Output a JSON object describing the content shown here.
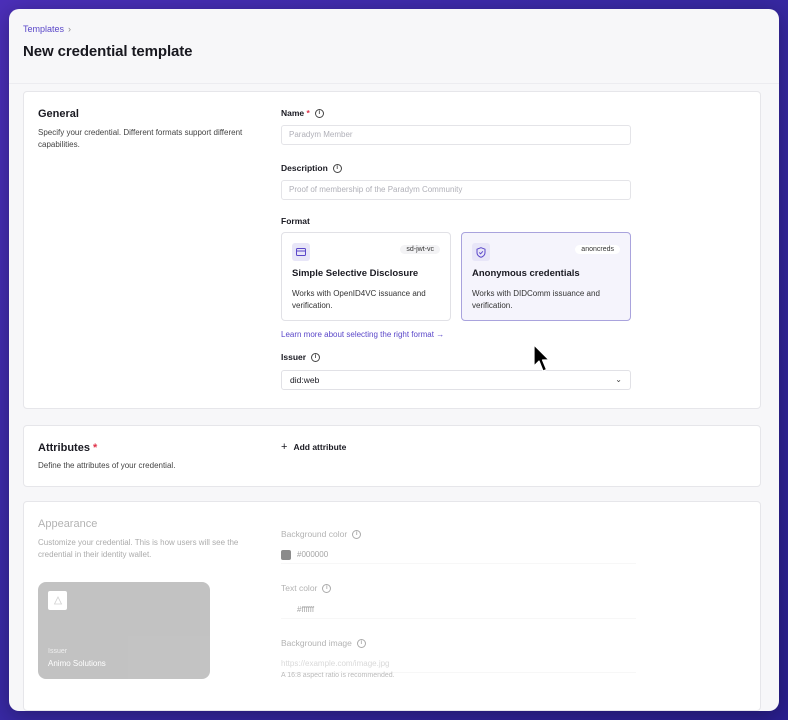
{
  "breadcrumb": {
    "parent": "Templates"
  },
  "page": {
    "title": "New credential template"
  },
  "general": {
    "title": "General",
    "description": "Specify your credential. Different formats support different capabilities.",
    "name_label": "Name",
    "name_required": "*",
    "name_placeholder": "Paradym Member",
    "description_label": "Description",
    "description_placeholder": "Proof of membership of the Paradym Community",
    "format_label": "Format",
    "formats": [
      {
        "badge": "sd-jwt-vc",
        "title": "Simple Selective Disclosure",
        "desc": "Works with OpenID4VC issuance and verification.",
        "icon": "credential-card-icon"
      },
      {
        "badge": "anoncreds",
        "title": "Anonymous credentials",
        "desc": "Works with DIDComm issuance and verification.",
        "icon": "shield-check-icon"
      }
    ],
    "learn_more": "Learn more about selecting the right format →",
    "issuer_label": "Issuer",
    "issuer_value": "did:web"
  },
  "attributes": {
    "title": "Attributes",
    "required": "*",
    "description": "Define the attributes of your credential.",
    "add_label": "Add attribute"
  },
  "appearance": {
    "title": "Appearance",
    "description": "Customize your credential. This is how users will see the credential in their identity wallet.",
    "bg_color_label": "Background color",
    "bg_color_value": "#000000",
    "text_color_label": "Text color",
    "text_color_value": "#ffffff",
    "bg_image_label": "Background image",
    "bg_image_placeholder": "https://example.com/image.jpg",
    "bg_image_hint": "A 16:8 aspect ratio is recommended.",
    "preview_issuer_label": "Issuer",
    "preview_issuer_name": "Animo Solutions"
  },
  "colors": {
    "accent": "#5a47c9",
    "required": "#e0334a",
    "preview_bg": "#7a7a7a"
  }
}
